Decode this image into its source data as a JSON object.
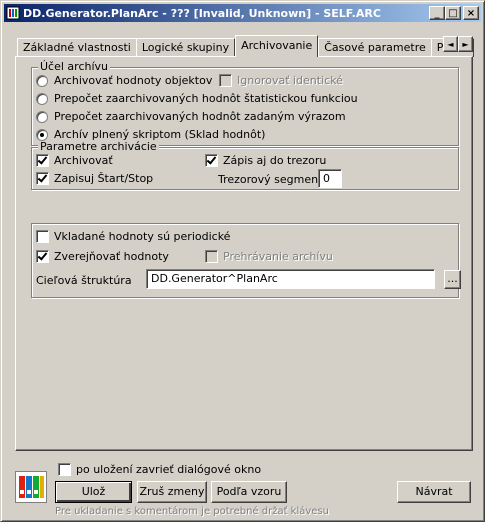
{
  "window": {
    "title": "DD.Generator.PlanArc - ??? [Invalid, Unknown] - SELF.ARC",
    "minimize_glyph": "_",
    "maximize_glyph": "□",
    "close_glyph": "×"
  },
  "tabs": [
    {
      "label": "Základné vlastnosti"
    },
    {
      "label": "Logické skupiny"
    },
    {
      "label": "Archivovanie"
    },
    {
      "label": "Časové parametre"
    },
    {
      "label": "Podmienka"
    }
  ],
  "tab_scroll": {
    "left": "◄",
    "right": "►"
  },
  "ucel": {
    "legend": "Účel archívu",
    "options": [
      {
        "label": "Archivovať hodnoty objektov",
        "selected": false
      },
      {
        "label": "Prepočet zaarchivovaných hodnôt štatistickou funkciou",
        "selected": false
      },
      {
        "label": "Prepočet zaarchivovaných hodnôt zadaným výrazom",
        "selected": false
      },
      {
        "label": "Archív plnený skriptom (Sklad hodnôt)",
        "selected": true
      }
    ],
    "ignorovat_label": "Ignorovať identické",
    "ignorovat_checked": false
  },
  "parametre": {
    "legend": "Parametre archivácie",
    "archivovat_label": "Archivovať",
    "archivovat_checked": true,
    "zapisovat_label": "Zapisuj Štart/Stop",
    "zapisovat_checked": true,
    "trezor_label": "Zápis aj do trezoru",
    "trezor_checked": true,
    "segment_label": "Trezorový segment",
    "segment_value": "0"
  },
  "hodnoty": {
    "periodicke_label": "Vkladané hodnoty sú periodické",
    "periodicke_checked": false,
    "zverejnovat_label": "Zverejňovať hodnoty",
    "zverejnovat_checked": true,
    "prehravanie_label": "Prehrávanie archívu",
    "prehravanie_checked": false,
    "struktura_label": "Cieľová štruktúra",
    "struktura_value": "DD.Generator^PlanArc",
    "browse_label": "..."
  },
  "footer": {
    "zavriet_label": "po uložení zavrieť dialógové okno",
    "zavriet_checked": false,
    "uloz_label": "Ulož",
    "zrus_label": "Zruš zmeny",
    "podla_label": "Podľa vzoru",
    "navrat_label": "Návrat",
    "hint": "Pre ukladanie s komentárom je potrebné držať klávesu"
  }
}
